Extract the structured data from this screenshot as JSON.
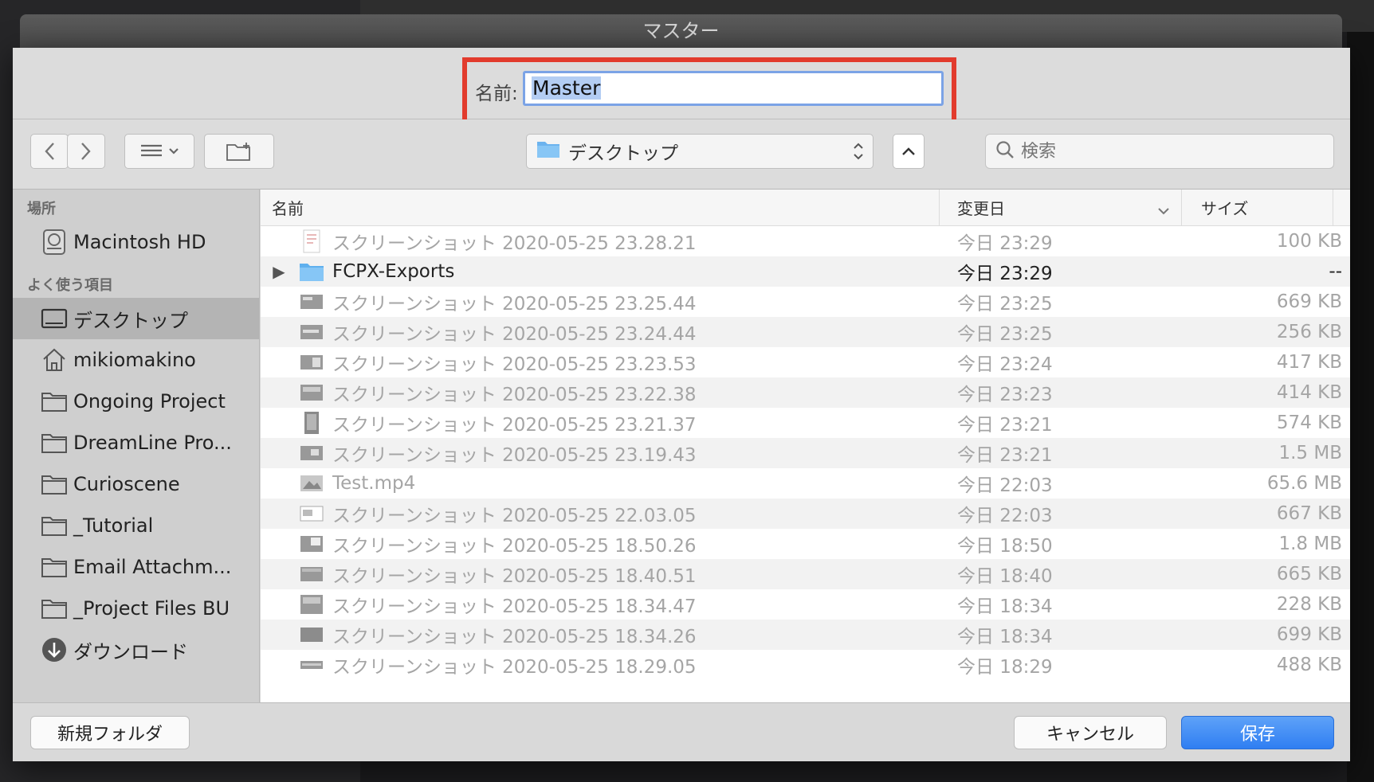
{
  "window": {
    "title": "マスター"
  },
  "save": {
    "name_label": "名前:",
    "name_value": "Master"
  },
  "toolbar": {
    "location": "デスクトップ",
    "search_placeholder": "検索"
  },
  "sidebar": {
    "sections": [
      {
        "title": "場所",
        "items": [
          {
            "label": "Macintosh HD",
            "icon": "harddisk-icon"
          }
        ]
      },
      {
        "title": "よく使う項目",
        "items": [
          {
            "label": "デスクトップ",
            "icon": "desktop-icon",
            "active": true
          },
          {
            "label": "mikiomakino",
            "icon": "home-icon"
          },
          {
            "label": "Ongoing Project",
            "icon": "folder-icon"
          },
          {
            "label": "DreamLine Pro...",
            "icon": "folder-icon"
          },
          {
            "label": "Curioscene",
            "icon": "folder-icon"
          },
          {
            "label": "_Tutorial",
            "icon": "folder-icon"
          },
          {
            "label": "Email Attachm...",
            "icon": "folder-icon"
          },
          {
            "label": "_Project Files BU",
            "icon": "folder-icon"
          },
          {
            "label": "ダウンロード",
            "icon": "download-icon"
          }
        ]
      }
    ]
  },
  "filelist": {
    "headers": {
      "name": "名前",
      "date": "変更日",
      "size": "サイズ"
    },
    "rows": [
      {
        "name": "スクリーンショット 2020-05-25 23.28.21",
        "date": "今日 23:29",
        "size": "100 KB",
        "type": "image"
      },
      {
        "name": "FCPX-Exports",
        "date": "今日 23:29",
        "size": "--",
        "type": "folder"
      },
      {
        "name": "スクリーンショット 2020-05-25 23.25.44",
        "date": "今日 23:25",
        "size": "669 KB",
        "type": "image"
      },
      {
        "name": "スクリーンショット 2020-05-25 23.24.44",
        "date": "今日 23:25",
        "size": "256 KB",
        "type": "image"
      },
      {
        "name": "スクリーンショット 2020-05-25 23.23.53",
        "date": "今日 23:24",
        "size": "417 KB",
        "type": "image"
      },
      {
        "name": "スクリーンショット 2020-05-25 23.22.38",
        "date": "今日 23:23",
        "size": "414 KB",
        "type": "image"
      },
      {
        "name": "スクリーンショット 2020-05-25 23.21.37",
        "date": "今日 23:21",
        "size": "574 KB",
        "type": "image"
      },
      {
        "name": "スクリーンショット 2020-05-25 23.19.43",
        "date": "今日 23:21",
        "size": "1.5 MB",
        "type": "image"
      },
      {
        "name": "Test.mp4",
        "date": "今日 22:03",
        "size": "65.6 MB",
        "type": "video"
      },
      {
        "name": "スクリーンショット 2020-05-25 22.03.05",
        "date": "今日 22:03",
        "size": "667 KB",
        "type": "image"
      },
      {
        "name": "スクリーンショット 2020-05-25 18.50.26",
        "date": "今日 18:50",
        "size": "1.8 MB",
        "type": "image"
      },
      {
        "name": "スクリーンショット 2020-05-25 18.40.51",
        "date": "今日 18:40",
        "size": "665 KB",
        "type": "image"
      },
      {
        "name": "スクリーンショット 2020-05-25 18.34.47",
        "date": "今日 18:34",
        "size": "228 KB",
        "type": "image"
      },
      {
        "name": "スクリーンショット 2020-05-25 18.34.26",
        "date": "今日 18:34",
        "size": "699 KB",
        "type": "image"
      },
      {
        "name": "スクリーンショット 2020-05-25 18.29.05",
        "date": "今日 18:29",
        "size": "488 KB",
        "type": "image"
      }
    ]
  },
  "footer": {
    "new_folder": "新規フォルダ",
    "cancel": "キャンセル",
    "save": "保存"
  },
  "colors": {
    "highlight_border": "#e23b2d",
    "primary_button": "#2f7ef2"
  }
}
